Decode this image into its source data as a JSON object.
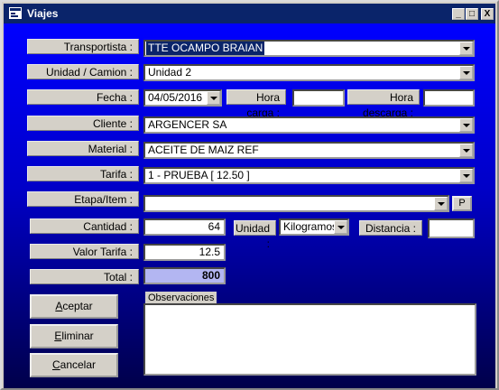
{
  "window": {
    "title": "Viajes",
    "app_icon": "form-icon"
  },
  "title_buttons": {
    "minimize": "_",
    "maximize": "□",
    "close": "X"
  },
  "labels": {
    "transportista": "Transportista :",
    "unidad": "Unidad / Camion :",
    "fecha": "Fecha :",
    "hora_carga": "Hora carga :",
    "hora_descarga": "Hora descarga :",
    "cliente": "Cliente :",
    "material": "Material :",
    "tarifa": "Tarifa :",
    "etapa": "Etapa/Item :",
    "cantidad": "Cantidad :",
    "unidad_medida": "Unidad :",
    "distancia": "Distancia :",
    "valor_tarifa": "Valor Tarifa :",
    "total": "Total :",
    "observaciones": "Observaciones"
  },
  "values": {
    "transportista": "TTE OCAMPO BRAIAN",
    "unidad": "Unidad 2",
    "fecha": "04/05/2016",
    "hora_carga": "",
    "hora_descarga": "",
    "cliente": "ARGENCER SA",
    "material": "ACEITE DE MAIZ REF",
    "tarifa": "1 - PRUEBA [ 12.50 ]",
    "etapa": "",
    "cantidad": "64",
    "unidad_medida": "Kilogramos",
    "distancia": "",
    "valor_tarifa": "12.5",
    "total": "800",
    "observaciones": ""
  },
  "buttons": {
    "etapa_p": "P",
    "aceptar": {
      "accel": "A",
      "rest": "ceptar"
    },
    "eliminar": {
      "accel": "E",
      "rest": "liminar"
    },
    "cancelar": {
      "accel": "C",
      "rest": "ancelar"
    }
  }
}
